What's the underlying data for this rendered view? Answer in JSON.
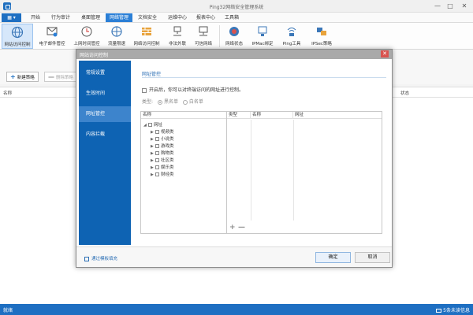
{
  "window": {
    "title": "Ping32网络安全管理系统",
    "minimize": "—",
    "maximize": "□",
    "close": "✕"
  },
  "menu": {
    "main_button": "▦ ▾",
    "items": [
      "开始",
      "行为审计",
      "桌面管理",
      "网络管理",
      "文档安全",
      "运维中心",
      "报表中心",
      "工具箱"
    ]
  },
  "ribbon": {
    "items": [
      {
        "label": "网站访问控制",
        "icon": "globe-icon"
      },
      {
        "label": "电子邮件管控",
        "icon": "email-icon"
      },
      {
        "label": "上网时间管控",
        "icon": "clock-icon"
      },
      {
        "label": "流量限速",
        "icon": "speed-icon"
      },
      {
        "label": "网络访问控制",
        "icon": "firewall-icon"
      },
      {
        "label": "非法外联",
        "icon": "network-icon"
      },
      {
        "label": "可信网络",
        "icon": "trusted-network-icon"
      },
      {
        "label": "网络状态",
        "icon": "network-status-icon"
      },
      {
        "label": "IPMac绑定",
        "icon": "ipmac-icon"
      },
      {
        "label": "Ping工具",
        "icon": "ping-icon"
      },
      {
        "label": "IPSec策略",
        "icon": "ipsec-icon"
      }
    ]
  },
  "toolbar": {
    "new_label": "新建策略",
    "delete_label": "删除策略"
  },
  "list": {
    "col_name": "名称",
    "col_status": "状态"
  },
  "statusbar": {
    "left": "就绪",
    "right": "5条未读信息"
  },
  "dialog": {
    "title": "网站访问控制",
    "nav": [
      "常规设置",
      "生效时间",
      "网址管控",
      "内容拦截"
    ],
    "section_title": "网址管控",
    "enable_text": "开启后，你可以对终端访问的网址进行控制。",
    "type_label": "类型:",
    "type_black": "黑名单",
    "type_white": "白名单",
    "tree": {
      "header": "名称",
      "root": "网址",
      "children": [
        "视频类",
        "小说类",
        "游戏类",
        "购物类",
        "社区类",
        "娱乐类",
        "财经类"
      ]
    },
    "grid": {
      "col_type": "类型",
      "col_name": "名称",
      "col_url": "网址"
    },
    "grid_add": "+",
    "grid_remove": "—",
    "restore_label": "通过模板填充",
    "ok": "确定",
    "cancel": "取消"
  }
}
